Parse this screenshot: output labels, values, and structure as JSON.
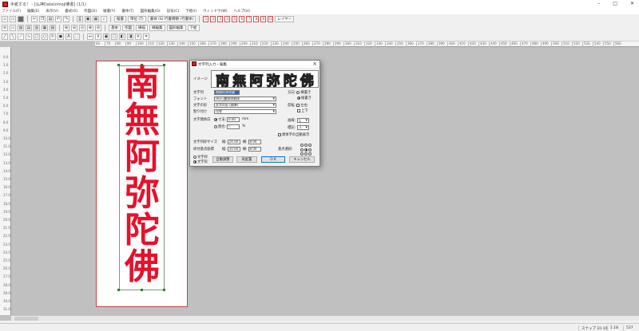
{
  "window": {
    "title": "半紙する！ - [仏神Data\\nmoji佛書] (1/1)",
    "controls": [
      "–",
      "□",
      "✕"
    ]
  },
  "menu": [
    "ファイル(F)",
    "編集(E)",
    "表示(V)",
    "書式(O)",
    "作図(D)",
    "縦書(Y)",
    "書体(T)",
    "図形編集(G)",
    "記号(C)",
    "下絵(I)",
    "ウィンドウ(W)",
    "ヘルプ(H)"
  ],
  "toolbar": {
    "row1_labels": [
      "縦書",
      "単位 (T)",
      "書体 (S) 行書明朝 (行書体)",
      "レイヤー"
    ],
    "layer_numbers": [
      "1",
      "2",
      "3",
      "4",
      "5",
      "6",
      "7",
      "8",
      "9",
      "10"
    ],
    "row2_labels": [
      "基本",
      "作図",
      "線描",
      "線編集",
      "図形編集",
      "下絵"
    ]
  },
  "ruler": {
    "h_ticks": [
      "60",
      "70",
      "80",
      "90",
      "100",
      "110",
      "120",
      "130",
      "140",
      "150",
      "160",
      "170",
      "180",
      "190",
      "200",
      "210",
      "220",
      "230",
      "240",
      "250",
      "260",
      "270",
      "280",
      "290",
      "300",
      "310",
      "320",
      "330",
      "340",
      "350",
      "360",
      "370",
      "380",
      "390",
      "400",
      "410",
      "420",
      "430",
      "440",
      "450",
      "460",
      "470",
      "480",
      "490",
      "500",
      "510",
      "520",
      "530",
      "540",
      "550",
      "560"
    ],
    "v_ticks": [
      "0.0",
      "1.0",
      "2.0",
      "3.0",
      "4.0",
      "5.0",
      "6.0",
      "7.0",
      "8.0",
      "9.0",
      "10.0",
      "11.0",
      "12.0",
      "13.0",
      "14.0",
      "15.0",
      "16.0",
      "17.0",
      "18.0",
      "19.0",
      "20.0",
      "21.0",
      "22.0",
      "23.0",
      "24.0",
      "25.0",
      "26.0",
      "27.0",
      "28.0",
      "29.0",
      "30.0",
      "31.0"
    ]
  },
  "canvas": {
    "characters": [
      "南",
      "無",
      "阿",
      "弥",
      "陀",
      "佛"
    ],
    "text_color": "#e8102a"
  },
  "dialog": {
    "title": "文字列入力・編集",
    "preview_label": "イメージ",
    "preview_chars": [
      "南",
      "無",
      "阿",
      "弥",
      "陀",
      "佛"
    ],
    "fields": {
      "text_label": "文字列",
      "text_value": "南無阿弥陀佛",
      "font_label": "フォント",
      "font_value": "HG行書体明朝体",
      "alt_font_label": "文字の形",
      "alt_font_value": "文字の形 (標準)",
      "align_label": "割り付け",
      "align_value": "均等",
      "spacing_label": "文字間余白",
      "spacing_radio1": "寸法:",
      "spacing_value1": "0.00",
      "spacing_unit1": "mm",
      "spacing_radio2": "割合:",
      "spacing_value2": "0",
      "spacing_unit2": "%",
      "size_label": "文字列枠サイズ",
      "size_h_label": "縦:",
      "size_h_value": "24.00",
      "size_w_label": "横:",
      "size_w_value": "8.00",
      "pos_label": "枠付基点座標",
      "pos_h_label": "縦:",
      "pos_h_value": "10.00",
      "pos_w_label": "横:",
      "pos_w_value": "8.00"
    },
    "right": {
      "dir_label": "方向:",
      "dir_opt1": "横書き",
      "dir_opt2": "縦書き",
      "flip_label": "反転:",
      "flip_opt1": "左右",
      "flip_opt2": "上下",
      "line_label": "画線:",
      "line_value": "1",
      "mark_label": "標記:",
      "mark_value": "下",
      "auto_check": "異体字の自動表示",
      "origin_label": "基点選択:"
    },
    "bottom_radios": [
      "文字枠",
      "文字形"
    ],
    "buttons": {
      "auto": "自動調整",
      "center": "再配置",
      "ok": "O K",
      "cancel": "キャンセル"
    }
  },
  "status": {
    "cells": [
      "スナップ 10.10",
      "1.18",
      "537"
    ]
  }
}
